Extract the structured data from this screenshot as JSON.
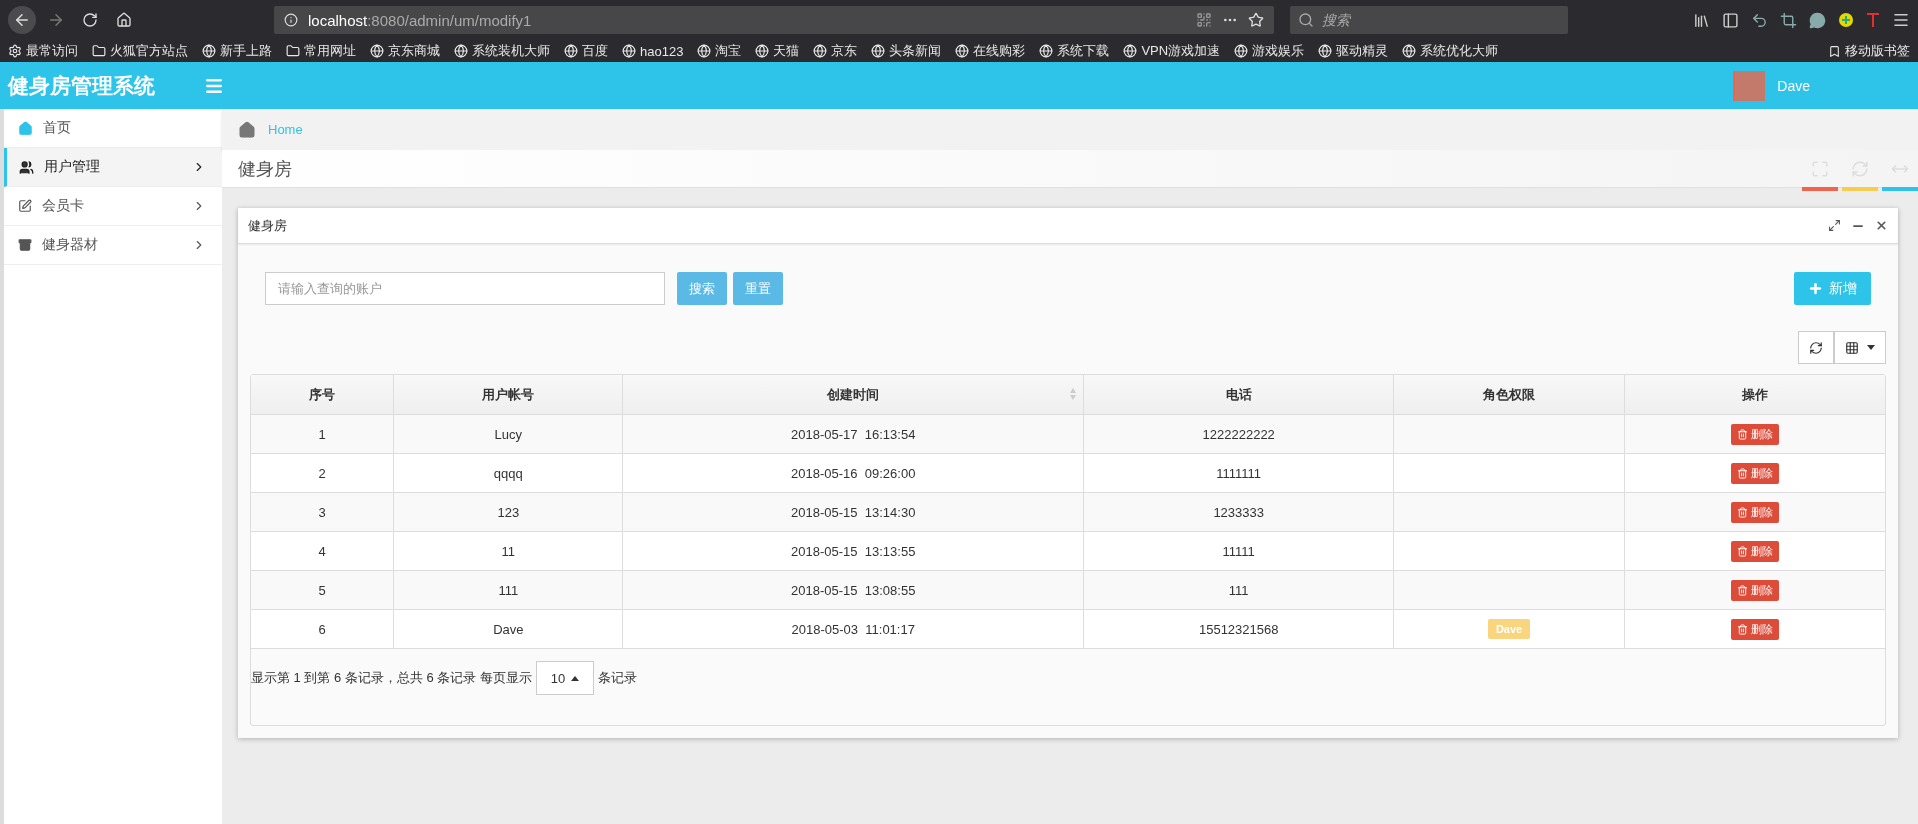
{
  "browser": {
    "url": {
      "host": "localhost",
      "rest": ":8080/admin/um/modify1"
    },
    "search": {
      "placeholder": "搜索"
    },
    "bookmarks": [
      {
        "label": "最常访问",
        "kind": "gear"
      },
      {
        "label": "火狐官方站点",
        "kind": "folder"
      },
      {
        "label": "新手上路",
        "kind": "globe"
      },
      {
        "label": "常用网址",
        "kind": "folder"
      },
      {
        "label": "京东商城",
        "kind": "globe"
      },
      {
        "label": "系统装机大师",
        "kind": "globe"
      },
      {
        "label": "百度",
        "kind": "globe"
      },
      {
        "label": "hao123",
        "kind": "globe"
      },
      {
        "label": "淘宝",
        "kind": "globe"
      },
      {
        "label": "天猫",
        "kind": "globe"
      },
      {
        "label": "京东",
        "kind": "globe"
      },
      {
        "label": "头条新闻",
        "kind": "globe"
      },
      {
        "label": "在线购彩",
        "kind": "globe"
      },
      {
        "label": "系统下载",
        "kind": "globe"
      },
      {
        "label": "VPN游戏加速",
        "kind": "globe"
      },
      {
        "label": "游戏娱乐",
        "kind": "globe"
      },
      {
        "label": "驱动精灵",
        "kind": "globe"
      },
      {
        "label": "系统优化大师",
        "kind": "globe"
      }
    ],
    "mobile_bookmarks": "移动版书签"
  },
  "app": {
    "title": "健身房管理系统",
    "user": "Dave"
  },
  "sidebar": {
    "items": [
      {
        "label": "首页",
        "kind": "home",
        "selected": false,
        "expandable": false
      },
      {
        "label": "用户管理",
        "kind": "users",
        "selected": true,
        "expandable": true
      },
      {
        "label": "会员卡",
        "kind": "edit",
        "selected": false,
        "expandable": true
      },
      {
        "label": "健身器材",
        "kind": "archive",
        "selected": false,
        "expandable": true
      }
    ]
  },
  "breadcrumb": "Home",
  "page_title": "健身房",
  "page_tools": [
    {
      "kind": "expand",
      "color": "#f0644d"
    },
    {
      "kind": "refresh",
      "color": "#f8cb51"
    },
    {
      "kind": "arrows",
      "color": "#2ec3e8"
    }
  ],
  "panel": {
    "title": "健身房",
    "search": {
      "placeholder": "请输入查询的账户"
    },
    "search_button": "搜索",
    "reset_button": "重置",
    "add_button": "新增",
    "table": {
      "columns": [
        {
          "label": "序号",
          "sortable": false
        },
        {
          "label": "用户帐号",
          "sortable": false
        },
        {
          "label": "创建时间",
          "sortable": true
        },
        {
          "label": "电话",
          "sortable": false
        },
        {
          "label": "角色权限",
          "sortable": false
        },
        {
          "label": "操作",
          "sortable": false
        }
      ],
      "rows": [
        {
          "no": "1",
          "account": "Lucy",
          "created": "2018-05-17  16:13:54",
          "phone": "1222222222",
          "action": "删除"
        },
        {
          "no": "2",
          "account": "qqqq",
          "created": "2018-05-16  09:26:00",
          "phone": "1111111",
          "action": "删除"
        },
        {
          "no": "3",
          "account": "123",
          "created": "2018-05-15  13:14:30",
          "phone": "1233333",
          "action": "删除"
        },
        {
          "no": "4",
          "account": "11",
          "created": "2018-05-15  13:13:55",
          "phone": "11111",
          "action": "删除"
        },
        {
          "no": "5",
          "account": "111",
          "created": "2018-05-15  13:08:55",
          "phone": "111",
          "action": "删除"
        },
        {
          "no": "6",
          "account": "Dave",
          "created": "2018-05-03  11:01:17",
          "phone": "15512321568",
          "role": "Dave",
          "action": "删除"
        }
      ]
    },
    "pagination": {
      "before": "显示第 1 到第 6 条记录，总共 6 条记录 每页显示",
      "page_size": "10",
      "after": "条记录"
    }
  }
}
